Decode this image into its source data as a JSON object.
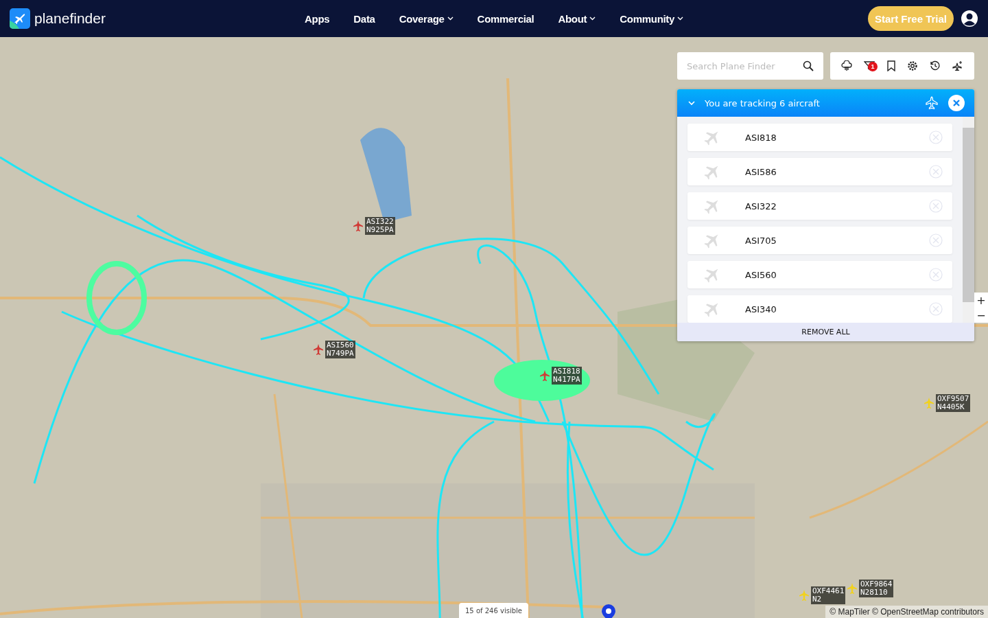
{
  "header": {
    "logo": "planefinder",
    "nav": [
      {
        "label": "Apps",
        "dropdown": false
      },
      {
        "label": "Data",
        "dropdown": false
      },
      {
        "label": "Coverage",
        "dropdown": true
      },
      {
        "label": "Commercial",
        "dropdown": false
      },
      {
        "label": "About",
        "dropdown": true
      },
      {
        "label": "Community",
        "dropdown": true
      }
    ],
    "cta": "Start Free Trial"
  },
  "search": {
    "placeholder": "Search Plane Finder"
  },
  "toolbar": {
    "filter_badge": "1"
  },
  "tracking": {
    "title": "You are tracking 6 aircraft",
    "items": [
      "ASI818",
      "ASI586",
      "ASI322",
      "ASI705",
      "ASI560",
      "ASI340"
    ],
    "remove_all": "REMOVE ALL"
  },
  "zoom": {
    "in": "+",
    "out": "−"
  },
  "aircraft": [
    {
      "callsign": "ASI322",
      "reg": "N925PA",
      "color": "#d03a36"
    },
    {
      "callsign": "ASI560",
      "reg": "N749PA",
      "color": "#d03a36"
    },
    {
      "callsign": "ASI818",
      "reg": "N417PA",
      "color": "#d03a36"
    },
    {
      "callsign": "OXF9507",
      "reg": "N4405K",
      "color": "#f2d21c"
    },
    {
      "callsign": "OXF9864",
      "reg": "N28110",
      "color": "#f2d21c"
    },
    {
      "callsign": "OXF4461",
      "reg": "N2",
      "color": "#f2d21c"
    }
  ],
  "visible_count": "15 of 246 visible",
  "attribution": "© MapTiler © OpenStreetMap contributors"
}
